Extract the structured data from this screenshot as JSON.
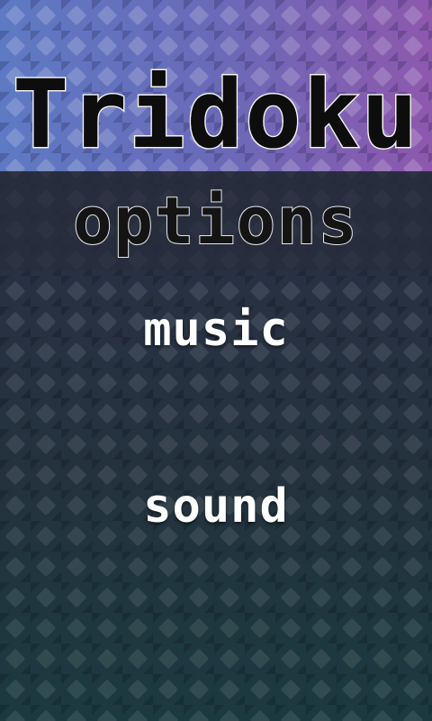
{
  "app": {
    "title": "Tridoku"
  },
  "screen": {
    "title": "options"
  },
  "menu": {
    "items": [
      {
        "label": "music"
      },
      {
        "label": "sound"
      }
    ]
  },
  "colors": {
    "bg_top_left": "#5a6bb8",
    "bg_top_right": "#8a5cb0",
    "bg_bottom": "#1e3a44",
    "menu_text": "#ffffff",
    "title_outline": "#f2f2f2",
    "title_fill": "#0d0d0d"
  }
}
